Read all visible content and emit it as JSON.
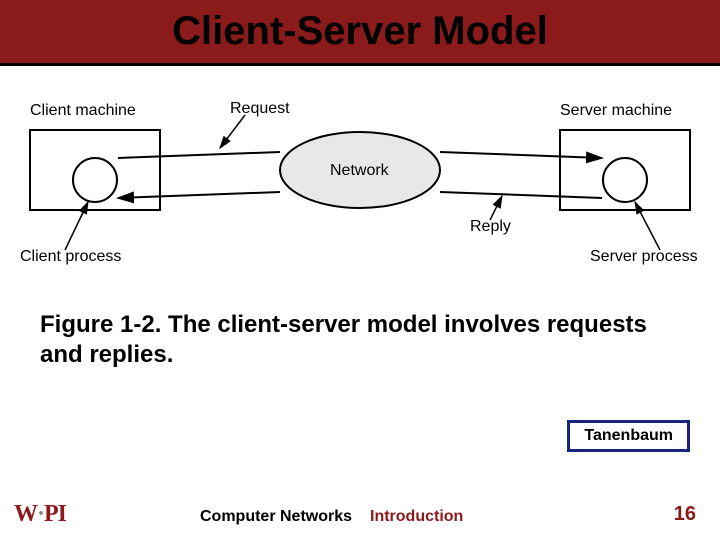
{
  "title": "Client-Server Model",
  "diagram": {
    "client_machine": "Client machine",
    "server_machine": "Server machine",
    "request": "Request",
    "reply": "Reply",
    "network": "Network",
    "client_process": "Client process",
    "server_process": "Server process"
  },
  "caption": "Figure 1-2. The client-server model involves requests and replies.",
  "attribution": "Tanenbaum",
  "footer": {
    "logo": "WPI",
    "course": "Computer Networks",
    "topic": "Introduction",
    "page": "16"
  }
}
